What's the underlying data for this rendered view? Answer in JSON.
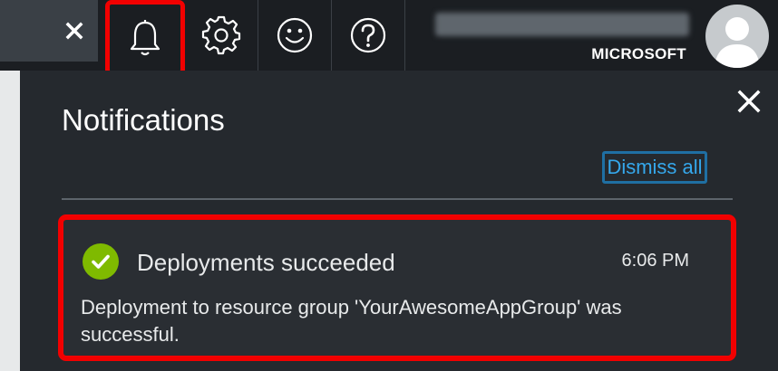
{
  "topbar": {
    "search_close_icon": "close-icon",
    "buttons": [
      {
        "name": "notifications",
        "icon": "bell-icon",
        "highlighted": true
      },
      {
        "name": "settings",
        "icon": "gear-icon"
      },
      {
        "name": "feedback",
        "icon": "smiley-icon"
      },
      {
        "name": "help",
        "icon": "question-icon"
      }
    ],
    "user": {
      "name_blurred": true,
      "tenant": "MICROSOFT",
      "avatar_icon": "person-icon"
    }
  },
  "panel": {
    "title": "Notifications",
    "close_icon": "close-icon",
    "dismiss_all": "Dismiss all",
    "notifications": [
      {
        "status_icon": "success-check-icon",
        "title": "Deployments succeeded",
        "time": "6:06 PM",
        "message": "Deployment to resource group 'YourAwesomeAppGroup' was successful.",
        "highlighted": true
      }
    ]
  },
  "colors": {
    "background": "#25292e",
    "topbar": "#1b1e22",
    "highlight": "#f20000",
    "link": "#35a8ec",
    "success": "#7fba00"
  }
}
